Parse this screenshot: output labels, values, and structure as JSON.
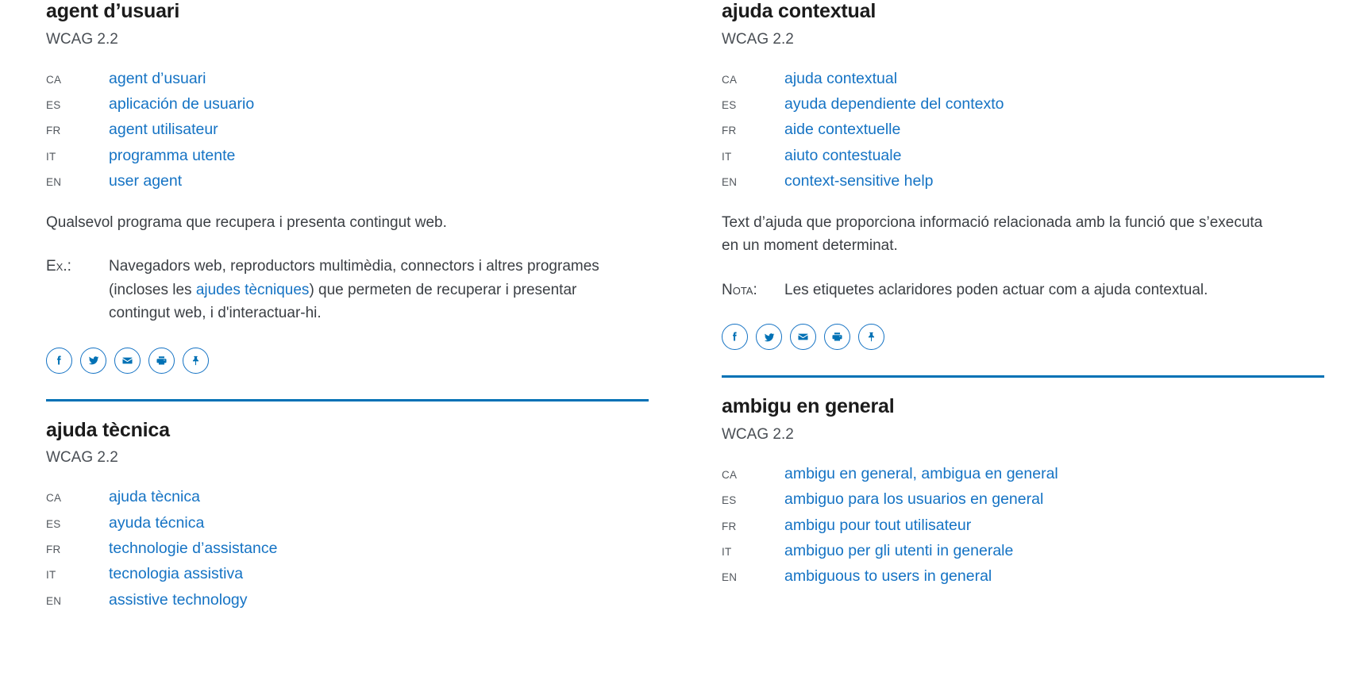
{
  "colors": {
    "link": "#1573c4",
    "rule": "#0071b5",
    "icon": "#0071b5",
    "heading": "#1b1b1b",
    "body": "#3b3f44"
  },
  "share": {
    "items": [
      {
        "name": "facebook-share-button",
        "label": "Facebook"
      },
      {
        "name": "twitter-share-button",
        "label": "Twitter"
      },
      {
        "name": "email-share-button",
        "label": "Correu"
      },
      {
        "name": "print-button",
        "label": "Imprimeix"
      },
      {
        "name": "pin-button",
        "label": "Fixa"
      }
    ]
  },
  "columns": [
    {
      "entries": [
        {
          "has_rule": false,
          "title": "agent d’usuari",
          "standard": "WCAG 2.2",
          "langs": [
            {
              "code": "CA",
              "term": "agent d’usuari"
            },
            {
              "code": "ES",
              "term": "aplicación de usuario"
            },
            {
              "code": "FR",
              "term": "agent utilisateur"
            },
            {
              "code": "IT",
              "term": "programma utente"
            },
            {
              "code": "EN",
              "term": "user agent"
            }
          ],
          "definition": "Qualsevol programa que recupera i presenta contingut web.",
          "note": {
            "label": "Ex.:",
            "text_before": "Navegadors web, reproductors multimèdia, connectors i altres programes (incloses les ",
            "link": "ajudes tècniques",
            "text_after": ") que permeten de recuperar i presentar contingut web, i d'interactuar-hi."
          },
          "has_share": true
        },
        {
          "has_rule": true,
          "title": "ajuda tècnica",
          "standard": "WCAG 2.2",
          "langs": [
            {
              "code": "CA",
              "term": "ajuda tècnica"
            },
            {
              "code": "ES",
              "term": "ayuda técnica"
            },
            {
              "code": "FR",
              "term": "technologie d’assistance"
            },
            {
              "code": "IT",
              "term": "tecnologia assistiva"
            },
            {
              "code": "EN",
              "term": "assistive technology"
            }
          ],
          "definition": "",
          "note": null,
          "has_share": false
        }
      ]
    },
    {
      "entries": [
        {
          "has_rule": false,
          "title": "ajuda contextual",
          "standard": "WCAG 2.2",
          "langs": [
            {
              "code": "CA",
              "term": "ajuda contextual"
            },
            {
              "code": "ES",
              "term": "ayuda dependiente del contexto"
            },
            {
              "code": "FR",
              "term": "aide contextuelle"
            },
            {
              "code": "IT",
              "term": "aiuto contestuale"
            },
            {
              "code": "EN",
              "term": "context-sensitive help"
            }
          ],
          "definition": "Text d’ajuda que proporciona informació relacionada amb la funció que s’executa en un moment determinat.",
          "note": {
            "label": "Nota:",
            "text_before": "Les etiquetes aclaridores poden actuar com a ajuda contextual.",
            "link": "",
            "text_after": ""
          },
          "has_share": true
        },
        {
          "has_rule": true,
          "title": "ambigu en general",
          "standard": "WCAG 2.2",
          "langs": [
            {
              "code": "CA",
              "term": "ambigu en general, ambigua en general"
            },
            {
              "code": "ES",
              "term": "ambiguo para los usuarios en general"
            },
            {
              "code": "FR",
              "term": "ambigu pour tout utilisateur"
            },
            {
              "code": "IT",
              "term": "ambiguo per gli utenti in generale"
            },
            {
              "code": "EN",
              "term": "ambiguous to users in general"
            }
          ],
          "definition": "",
          "note": null,
          "has_share": false
        }
      ]
    }
  ]
}
